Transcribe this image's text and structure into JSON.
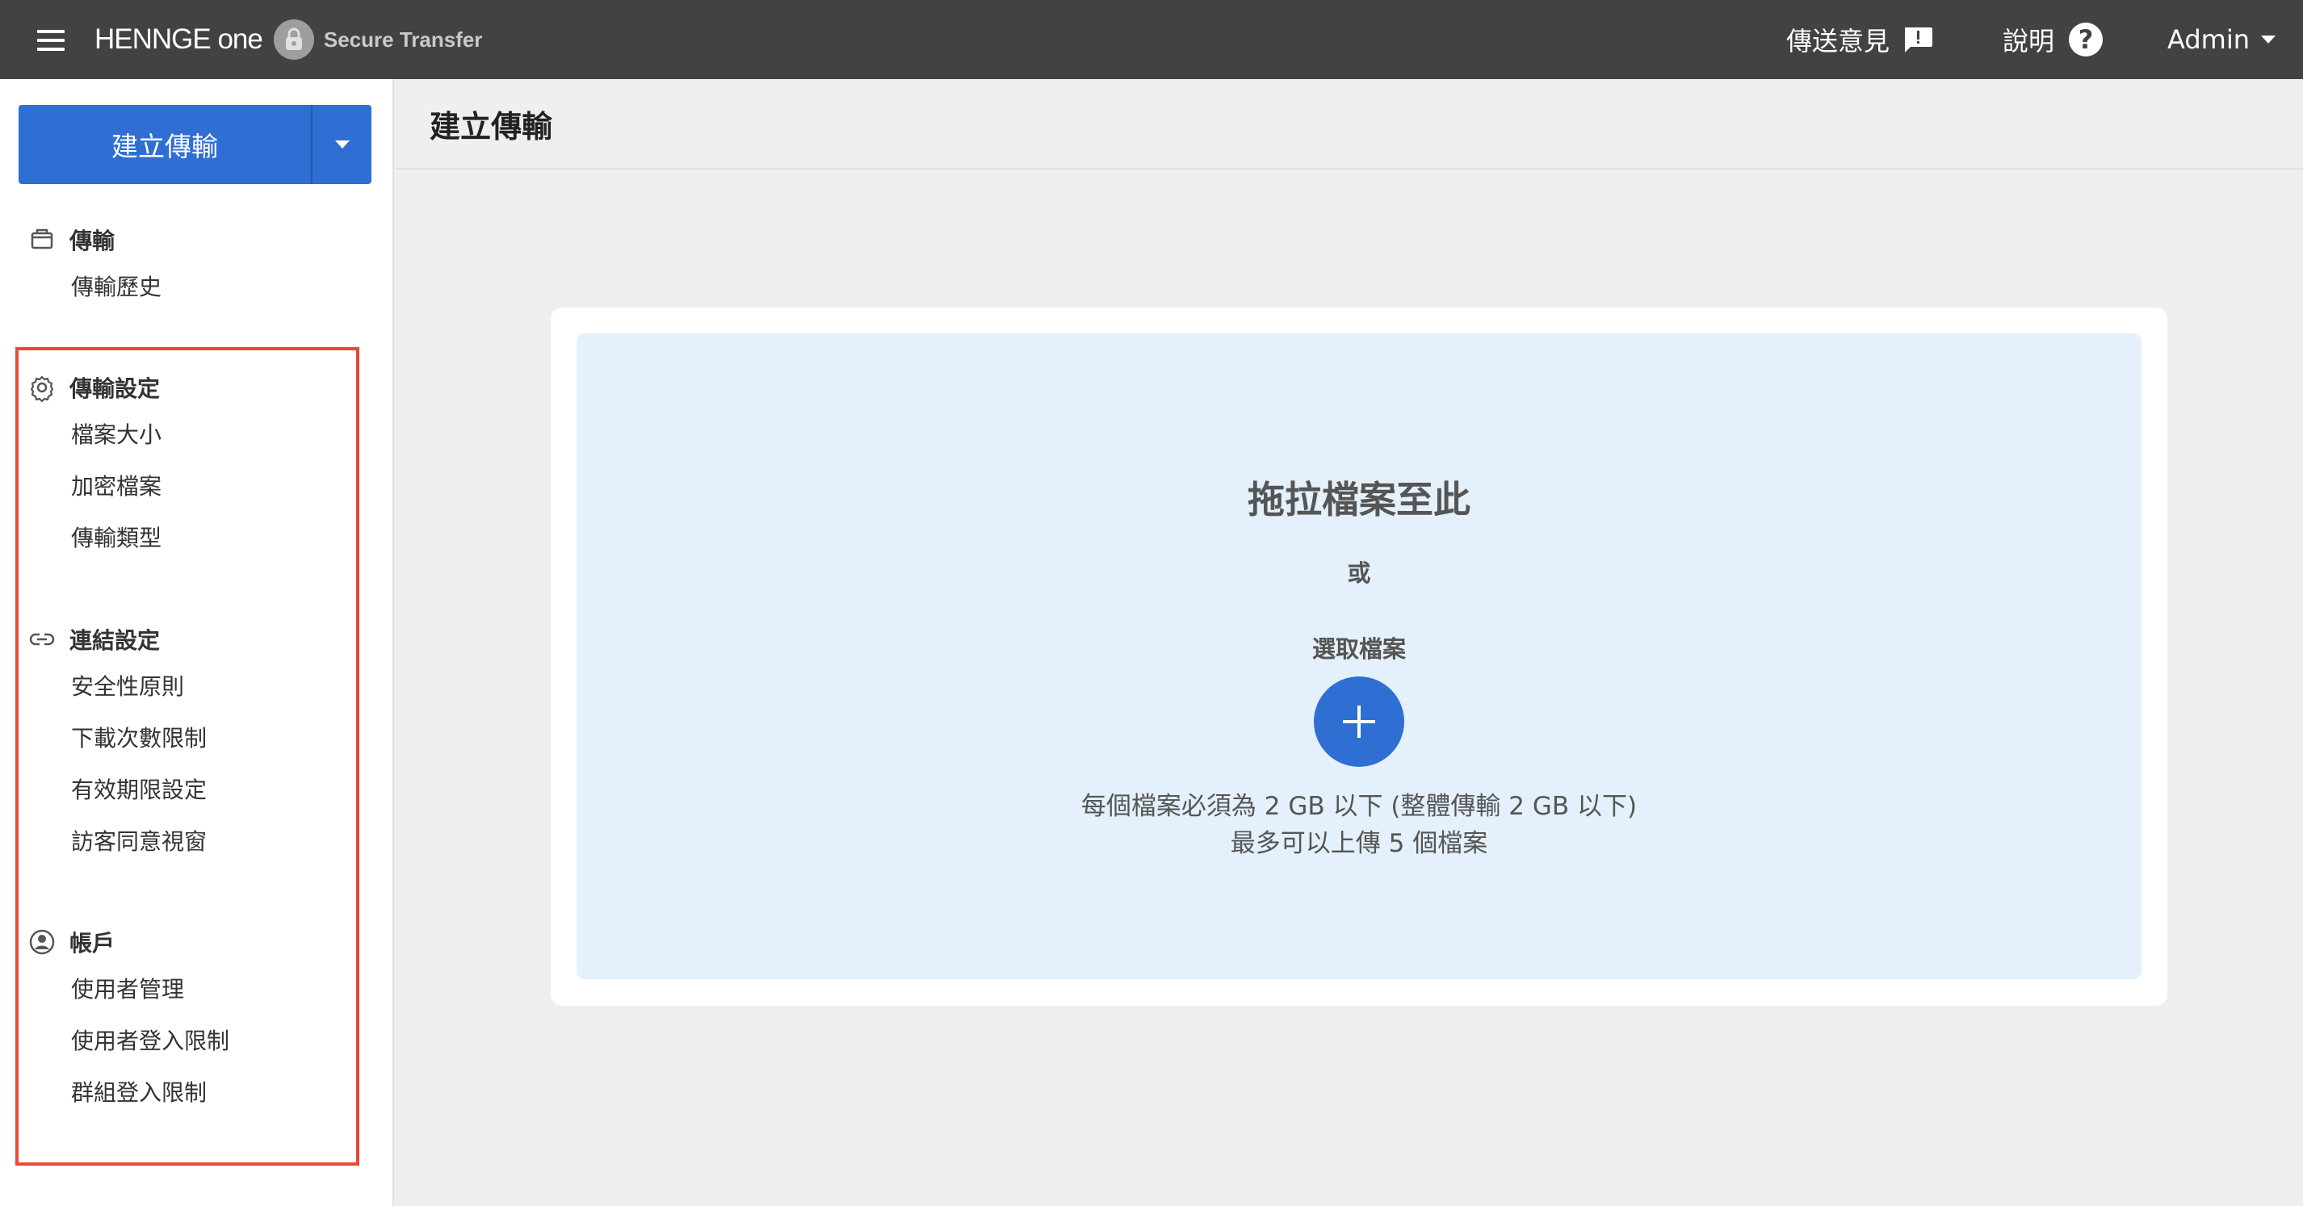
{
  "topbar": {
    "brand_name": "HENNGE one",
    "product_name": "Secure Transfer",
    "feedback_label": "傳送意見",
    "help_label": "說明",
    "help_icon_glyph": "?",
    "user_label": "Admin"
  },
  "sidebar": {
    "create_button_label": "建立傳輸",
    "sections": [
      {
        "title": "傳輸",
        "icon": "box-icon",
        "items": [
          "傳輸歷史"
        ]
      },
      {
        "title": "傳輸設定",
        "icon": "gear-icon",
        "items": [
          "檔案大小",
          "加密檔案",
          "傳輸類型"
        ]
      },
      {
        "title": "連結設定",
        "icon": "link-icon",
        "items": [
          "安全性原則",
          "下載次數限制",
          "有效期限設定",
          "訪客同意視窗"
        ]
      },
      {
        "title": "帳戶",
        "icon": "account-icon",
        "items": [
          "使用者管理",
          "使用者登入限制",
          "群組登入限制"
        ]
      }
    ],
    "highlight_color": "#e84a36"
  },
  "main": {
    "title": "建立傳輸",
    "dropzone": {
      "title": "拖拉檔案至此",
      "or_label": "或",
      "select_label": "選取檔案",
      "size_note": "每個檔案必須為 2 GB 以下 (整體傳輸 2 GB 以下)",
      "count_note": "最多可以上傳 5 個檔案"
    }
  },
  "colors": {
    "topbar_bg": "#424242",
    "accent": "#2f6fd3",
    "dropzone_bg": "#e4f0fb",
    "page_bg": "#efefef"
  }
}
